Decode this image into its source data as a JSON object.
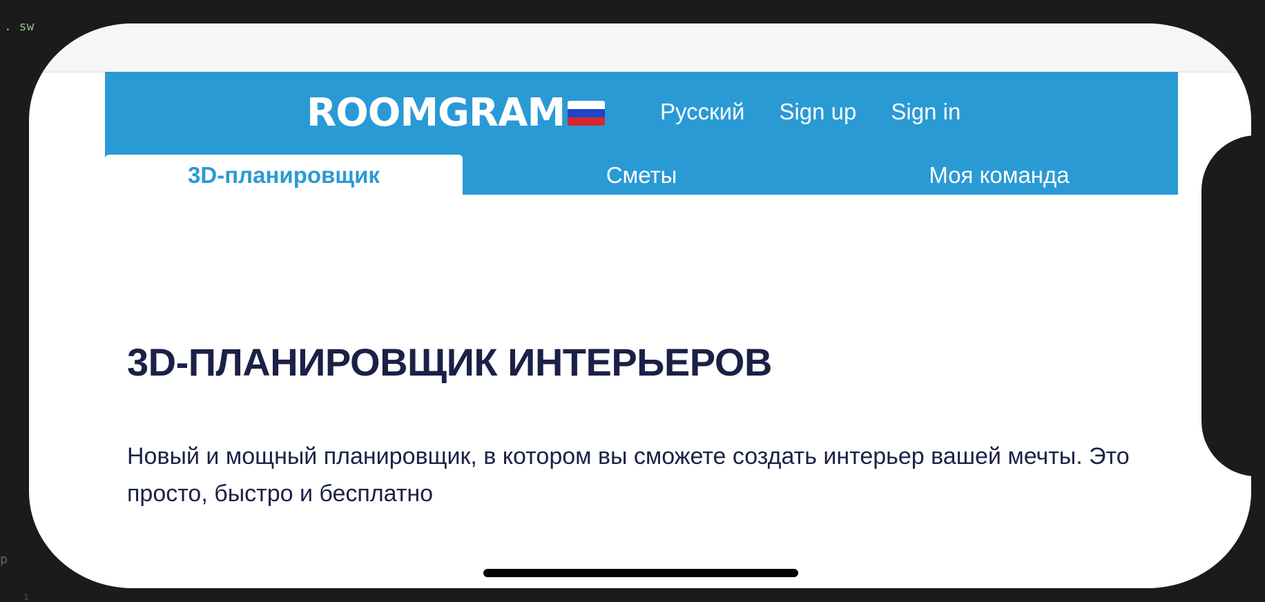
{
  "background": {
    "code_snippet_top": ". sw",
    "code_snippet_bottom": "p",
    "code_snippet_line": "1"
  },
  "header": {
    "logo": "ROOMGRAM",
    "flag_colors": [
      "#ffffff",
      "#1f46c8",
      "#d6282c"
    ],
    "language_link": "Русский",
    "signup_link": "Sign up",
    "signin_link": "Sign in"
  },
  "tabs": [
    {
      "label": "3D-планировщик",
      "active": true
    },
    {
      "label": "Сметы",
      "active": false
    },
    {
      "label": "Моя команда",
      "active": false
    }
  ],
  "hero": {
    "title": "3D-ПЛАНИРОВЩИК ИНТЕРЬЕРОВ",
    "description": "Новый и мощный планировщик, в котором вы сможете создать интерьер вашей мечты. Это просто, быстро и бесплатно"
  },
  "colors": {
    "brand_blue": "#2a9ad5",
    "text_dark": "#1b2146"
  }
}
